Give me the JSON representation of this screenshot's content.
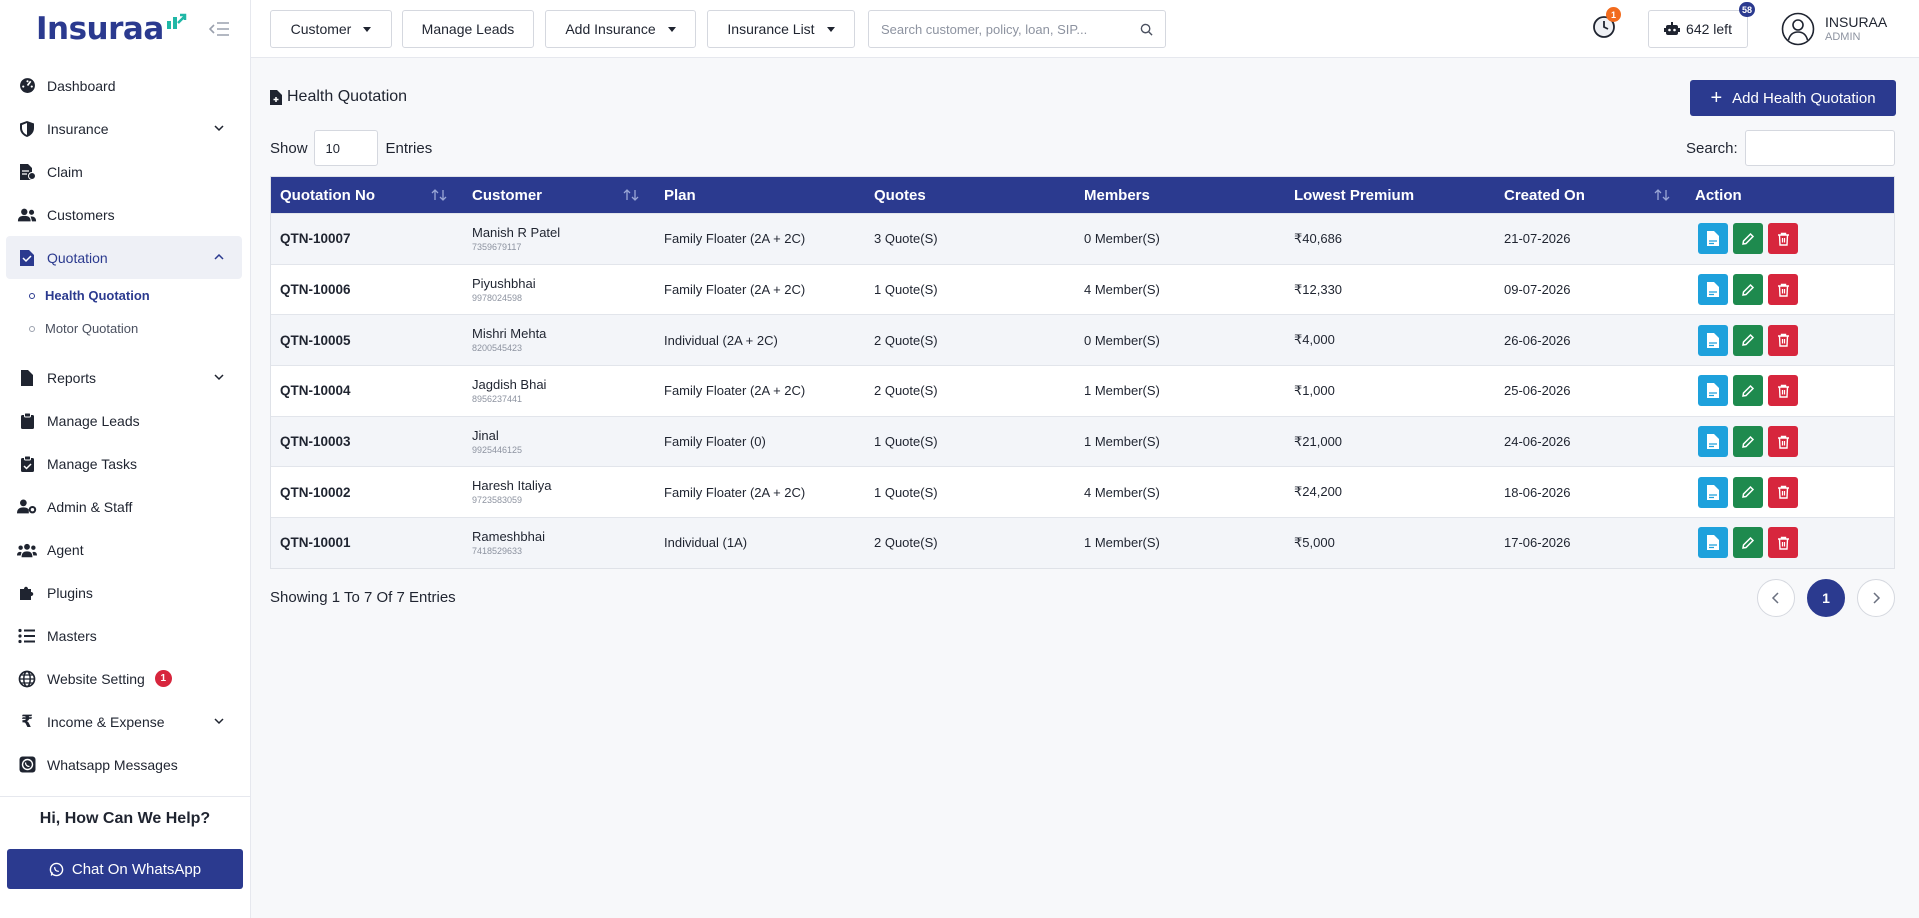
{
  "brand": {
    "name": "Insuraa"
  },
  "sidebar": {
    "items": [
      {
        "label": "Dashboard"
      },
      {
        "label": "Insurance"
      },
      {
        "label": "Claim"
      },
      {
        "label": "Customers"
      },
      {
        "label": "Quotation"
      },
      {
        "label": "Reports"
      },
      {
        "label": "Manage Leads"
      },
      {
        "label": "Manage Tasks"
      },
      {
        "label": "Admin & Staff"
      },
      {
        "label": "Agent"
      },
      {
        "label": "Plugins"
      },
      {
        "label": "Masters"
      },
      {
        "label": "Website Setting",
        "badge": "1"
      },
      {
        "label": "Income & Expense"
      },
      {
        "label": "Whatsapp Messages"
      }
    ],
    "sub_items": [
      {
        "label": "Health Quotation"
      },
      {
        "label": "Motor Quotation"
      }
    ],
    "help_title": "Hi, How Can We Help?",
    "whatsapp_label": "Chat On WhatsApp"
  },
  "topbar": {
    "customer_label": "Customer",
    "manage_leads_label": "Manage Leads",
    "add_insurance_label": "Add Insurance",
    "insurance_list_label": "Insurance List",
    "search_placeholder": "Search customer, policy, loan, SIP...",
    "clock_badge": "1",
    "credits_label": "642 left",
    "credits_badge": "58",
    "user_name": "INSURAA",
    "user_role": "ADMIN"
  },
  "page": {
    "title": "Health Quotation",
    "add_button": "Add Health Quotation",
    "show_label": "Show",
    "entries_value": "10",
    "entries_label": "Entries",
    "search_label": "Search:",
    "showing_text": "Showing 1 To 7 Of 7 Entries",
    "current_page": "1"
  },
  "table": {
    "headers": [
      "Quotation No",
      "Customer",
      "Plan",
      "Quotes",
      "Members",
      "Lowest Premium",
      "Created On",
      "Action"
    ],
    "rows": [
      {
        "no": "QTN-10007",
        "customer": "Manish R Patel",
        "phone": "7359679117",
        "plan": "Family Floater (2A + 2C)",
        "quotes": "3 Quote(S)",
        "members": "0 Member(S)",
        "premium": "₹40,686",
        "created": "21-07-2026"
      },
      {
        "no": "QTN-10006",
        "customer": "Piyushbhai",
        "phone": "9978024598",
        "plan": "Family Floater (2A + 2C)",
        "quotes": "1 Quote(S)",
        "members": "4 Member(S)",
        "premium": "₹12,330",
        "created": "09-07-2026"
      },
      {
        "no": "QTN-10005",
        "customer": "Mishri Mehta",
        "phone": "8200545423",
        "plan": "Individual (2A + 2C)",
        "quotes": "2 Quote(S)",
        "members": "0 Member(S)",
        "premium": "₹4,000",
        "created": "26-06-2026"
      },
      {
        "no": "QTN-10004",
        "customer": "Jagdish Bhai",
        "phone": "8956237441",
        "plan": "Family Floater (2A + 2C)",
        "quotes": "2 Quote(S)",
        "members": "1 Member(S)",
        "premium": "₹1,000",
        "created": "25-06-2026"
      },
      {
        "no": "QTN-10003",
        "customer": "Jinal",
        "phone": "9925446125",
        "plan": "Family Floater (0)",
        "quotes": "1 Quote(S)",
        "members": "1 Member(S)",
        "premium": "₹21,000",
        "created": "24-06-2026"
      },
      {
        "no": "QTN-10002",
        "customer": "Haresh Italiya",
        "phone": "9723583059",
        "plan": "Family Floater (2A + 2C)",
        "quotes": "1 Quote(S)",
        "members": "4 Member(S)",
        "premium": "₹24,200",
        "created": "18-06-2026"
      },
      {
        "no": "QTN-10001",
        "customer": "Rameshbhai",
        "phone": "7418529633",
        "plan": "Individual (1A)",
        "quotes": "2 Quote(S)",
        "members": "1 Member(S)",
        "premium": "₹5,000",
        "created": "17-06-2026"
      }
    ]
  },
  "colors": {
    "primary": "#2b3a8f",
    "view": "#1ea1dc",
    "edit": "#1e8a4e",
    "delete": "#d7263d",
    "badge_orange": "#f26b1d"
  }
}
